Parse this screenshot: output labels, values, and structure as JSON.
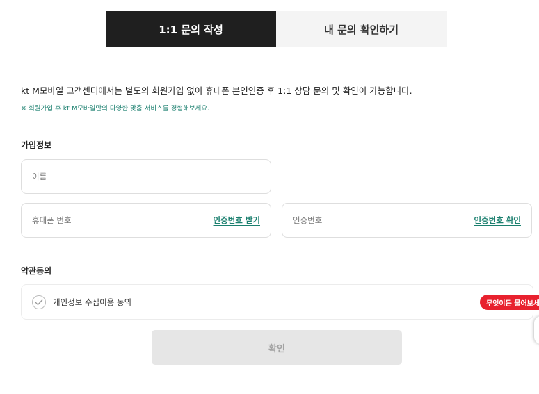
{
  "tabs": [
    {
      "label": "1:1 문의 작성",
      "active": true
    },
    {
      "label": "내 문의 확인하기",
      "active": false
    }
  ],
  "intro_text": "kt M모바일 고객센터에서는 별도의 회원가입 없이 휴대폰 본인인증 후 1:1 상담 문의 및 확인이 가능합니다.",
  "notice_text": "※ 회원가입 후 kt M모바일만의 다양한 맞춤 서비스를 경험해보세요.",
  "signup_section": {
    "title": "가입정보",
    "name_placeholder": "이름",
    "phone_placeholder": "휴대폰 번호",
    "request_code_label": "인증번호 받기",
    "code_placeholder": "인증번호",
    "verify_code_label": "인증번호 확인"
  },
  "terms_section": {
    "title": "약관동의",
    "privacy_consent_label": "개인정보 수집이용 동의"
  },
  "floating_badge": "무엇이든 물어보세요",
  "confirm_label": "확인",
  "colors": {
    "active_tab": "#1f1f1f",
    "accent_teal": "#1a7f6e",
    "badge_red": "#e8212e",
    "disabled_button": "#e6e6e6"
  }
}
